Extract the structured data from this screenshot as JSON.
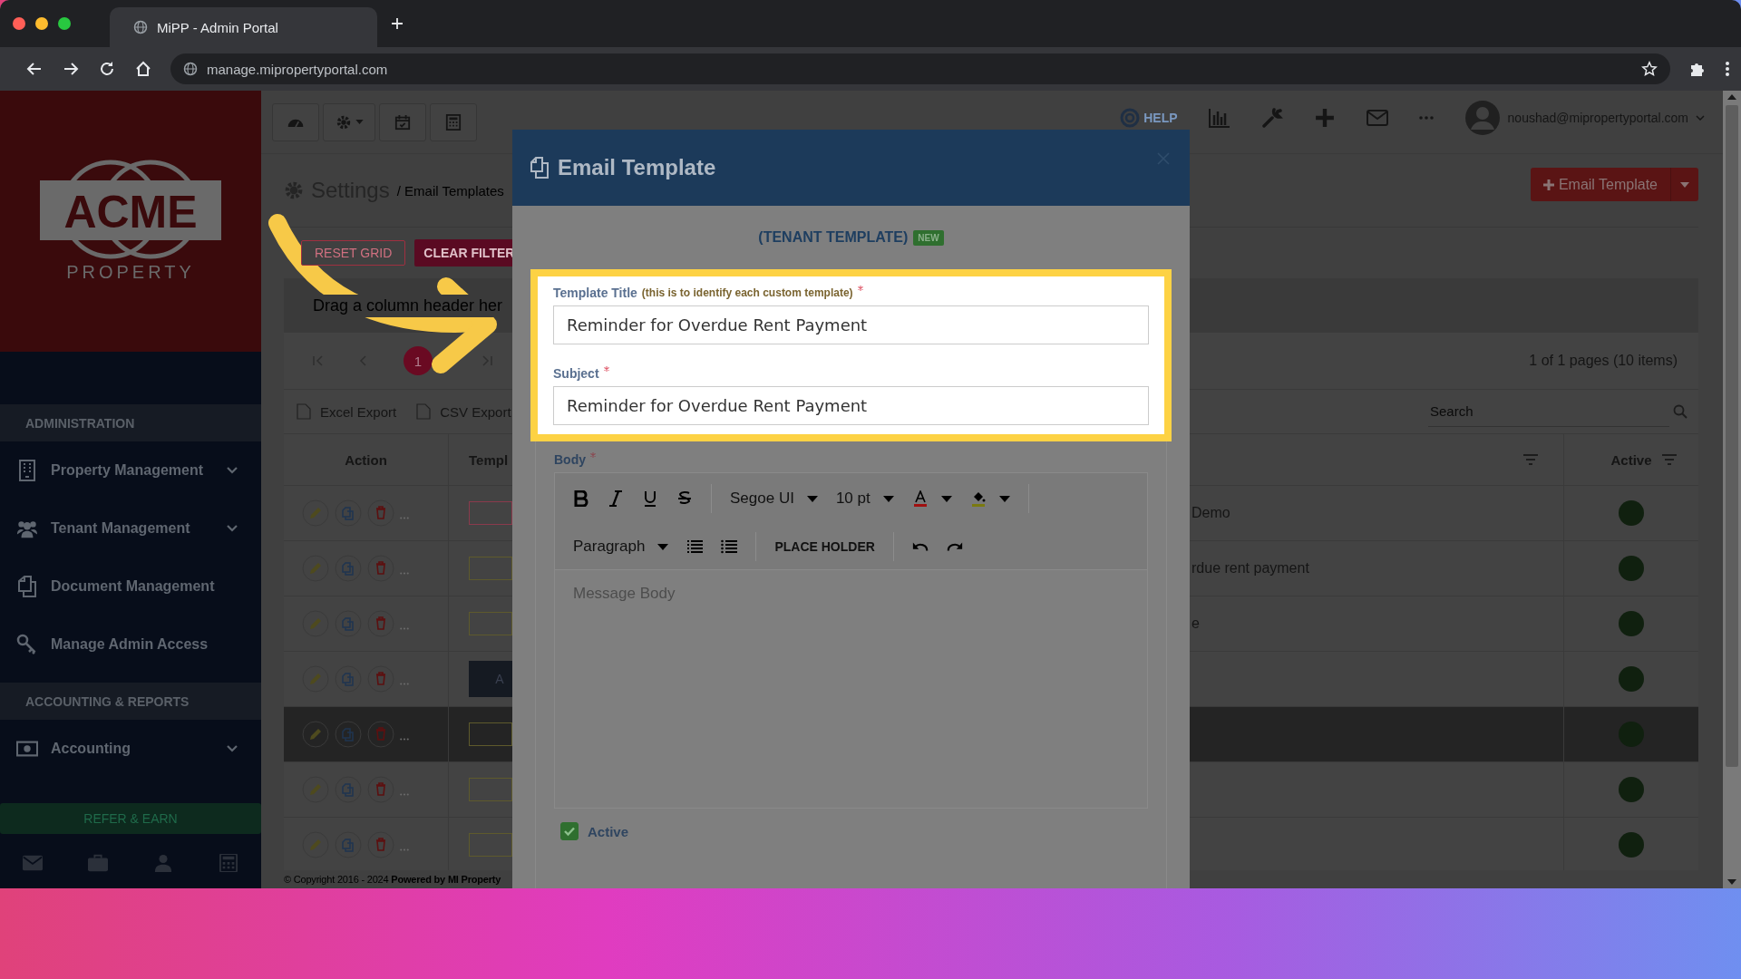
{
  "browser": {
    "tab_title": "MiPP - Admin Portal",
    "url": "manage.mipropertyportal.com"
  },
  "sidebar": {
    "logo": {
      "name": "ACME",
      "tagline": "PROPERTY"
    },
    "sections": [
      {
        "title": "ADMINISTRATION",
        "items": [
          {
            "label": "Property Management",
            "expandable": true
          },
          {
            "label": "Tenant Management",
            "expandable": true
          },
          {
            "label": "Document Management",
            "expandable": false
          },
          {
            "label": "Manage Admin Access",
            "expandable": false
          }
        ]
      },
      {
        "title": "ACCOUNTING & REPORTS",
        "items": [
          {
            "label": "Accounting",
            "expandable": true
          }
        ]
      }
    ],
    "refer_button": "REFER & EARN"
  },
  "top_nav": {
    "help": "HELP",
    "user": "noushad@mipropertyportal.com"
  },
  "page": {
    "title": "Settings",
    "breadcrumb": "/ Email Templates",
    "add_button": "Email Template",
    "reset_button": "RESET GRID",
    "clear_button": "CLEAR FILTER",
    "group_hint": "Drag a column header her",
    "current_page": "1",
    "page_info": "1 of 1 pages (10 items)",
    "exports": [
      "Excel Export",
      "CSV Export"
    ],
    "search": {
      "placeholder": "Search"
    }
  },
  "grid": {
    "columns": {
      "action": "Action",
      "template": "Templ",
      "active": "Active"
    },
    "rows": [
      {
        "template": {
          "kind": "tag",
          "color": "#8a3a4c"
        },
        "column_3": "Demo",
        "active": true,
        "selected": false
      },
      {
        "template": {
          "kind": "tag",
          "color": "#5e5a2c"
        },
        "column_3": "rdue rent payment",
        "active": true,
        "selected": false
      },
      {
        "template": {
          "kind": "tag",
          "color": "#5e5a2c"
        },
        "column_3": "e",
        "active": true,
        "selected": false
      },
      {
        "template": {
          "kind": "button",
          "label": "A"
        },
        "active": true,
        "selected": false
      },
      {
        "template": {
          "kind": "tag",
          "color": "#5e5a2c"
        },
        "active": true,
        "selected": true
      },
      {
        "template": {
          "kind": "tag",
          "color": "#5e5a2c"
        },
        "active": true,
        "selected": false
      },
      {
        "template": {
          "kind": "tag",
          "color": "#5e5a2c"
        },
        "active": true,
        "selected": false
      }
    ]
  },
  "footer": "© Copyright 2016 - 2024 **Powered by MI Property**",
  "modal": {
    "title": "Email Template",
    "template_type": "(TENANT TEMPLATE)",
    "badge": "NEW",
    "fields": [
      {
        "label": "Template Title",
        "hint": "(this is to identify each custom template)",
        "required": true,
        "value": "Reminder for Overdue Rent Payment"
      },
      {
        "label": "Subject",
        "required": true,
        "value": "Reminder for Overdue Rent Payment"
      }
    ],
    "body": {
      "label": "Body",
      "required": true,
      "font": "Segoe UI",
      "size": "10 pt",
      "format": "Paragraph",
      "placeholder_button": "PLACE HOLDER",
      "placeholder": "Message Body"
    },
    "active": {
      "label": "Active",
      "checked": true
    }
  }
}
